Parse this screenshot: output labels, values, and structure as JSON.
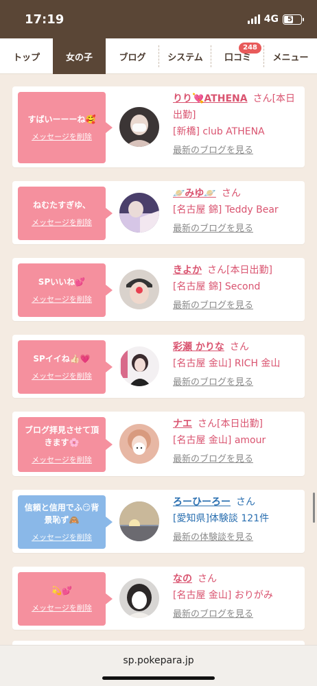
{
  "status": {
    "time": "17:19",
    "network": "4G",
    "battery": "51",
    "battery_level": 0.51
  },
  "nav": {
    "tabs": [
      {
        "label": "トップ"
      },
      {
        "label": "女の子",
        "active": true
      },
      {
        "label": "ブログ"
      },
      {
        "label": "システム"
      },
      {
        "label": "口コミ",
        "badge": "248"
      },
      {
        "label": "メニュー"
      }
    ]
  },
  "messages": [
    {
      "bubble": "すばいーーーね🥰",
      "delete": "メッセージを削除",
      "name": "りり💘ATHENA",
      "san": "さん",
      "status": "[本日出勤]",
      "shop": "[新橋] club ATHENA",
      "link": "最新のブログを見る",
      "type": "pink"
    },
    {
      "bubble": "ねむたすぎゆ、",
      "delete": "メッセージを削除",
      "name": "🪐みゆ🪐",
      "san": "さん",
      "status": "",
      "shop": "[名古屋 錦] Teddy Bear",
      "link": "最新のブログを見る",
      "type": "pink"
    },
    {
      "bubble": "SPいいね💕",
      "delete": "メッセージを削除",
      "name": "きよか",
      "san": "さん",
      "status": "[本日出勤]",
      "shop": "[名古屋 錦] Second",
      "link": "最新のブログを見る",
      "type": "pink"
    },
    {
      "bubble": "SPイイね👍🏻💗",
      "delete": "メッセージを削除",
      "name": "彩瀬 かりな",
      "san": "さん",
      "status": "",
      "shop": "[名古屋 金山] RICH 金山",
      "link": "最新のブログを見る",
      "type": "pink"
    },
    {
      "bubble": "ブログ拝見させて頂きます🌸",
      "delete": "メッセージを削除",
      "name": "ナエ",
      "san": "さん",
      "status": "[本日出勤]",
      "shop": "[名古屋 金山] amour",
      "link": "最新のブログを見る",
      "type": "pink"
    },
    {
      "bubble": "信頼と信用でふ😏背景恥ず🙈",
      "delete": "メッセージを削除",
      "name": "ろーひーろー",
      "san": "さん",
      "status": "",
      "shop": "[愛知県]体験談 121件",
      "link": "最新の体験談を見る",
      "type": "blue"
    },
    {
      "bubble": "💫💕",
      "delete": "メッセージを削除",
      "name": "なの",
      "san": "さん",
      "status": "",
      "shop": "[名古屋 金山] おりがみ",
      "link": "最新のブログを見る",
      "type": "pink"
    }
  ],
  "browser": {
    "url": "sp.pokepara.jp"
  }
}
